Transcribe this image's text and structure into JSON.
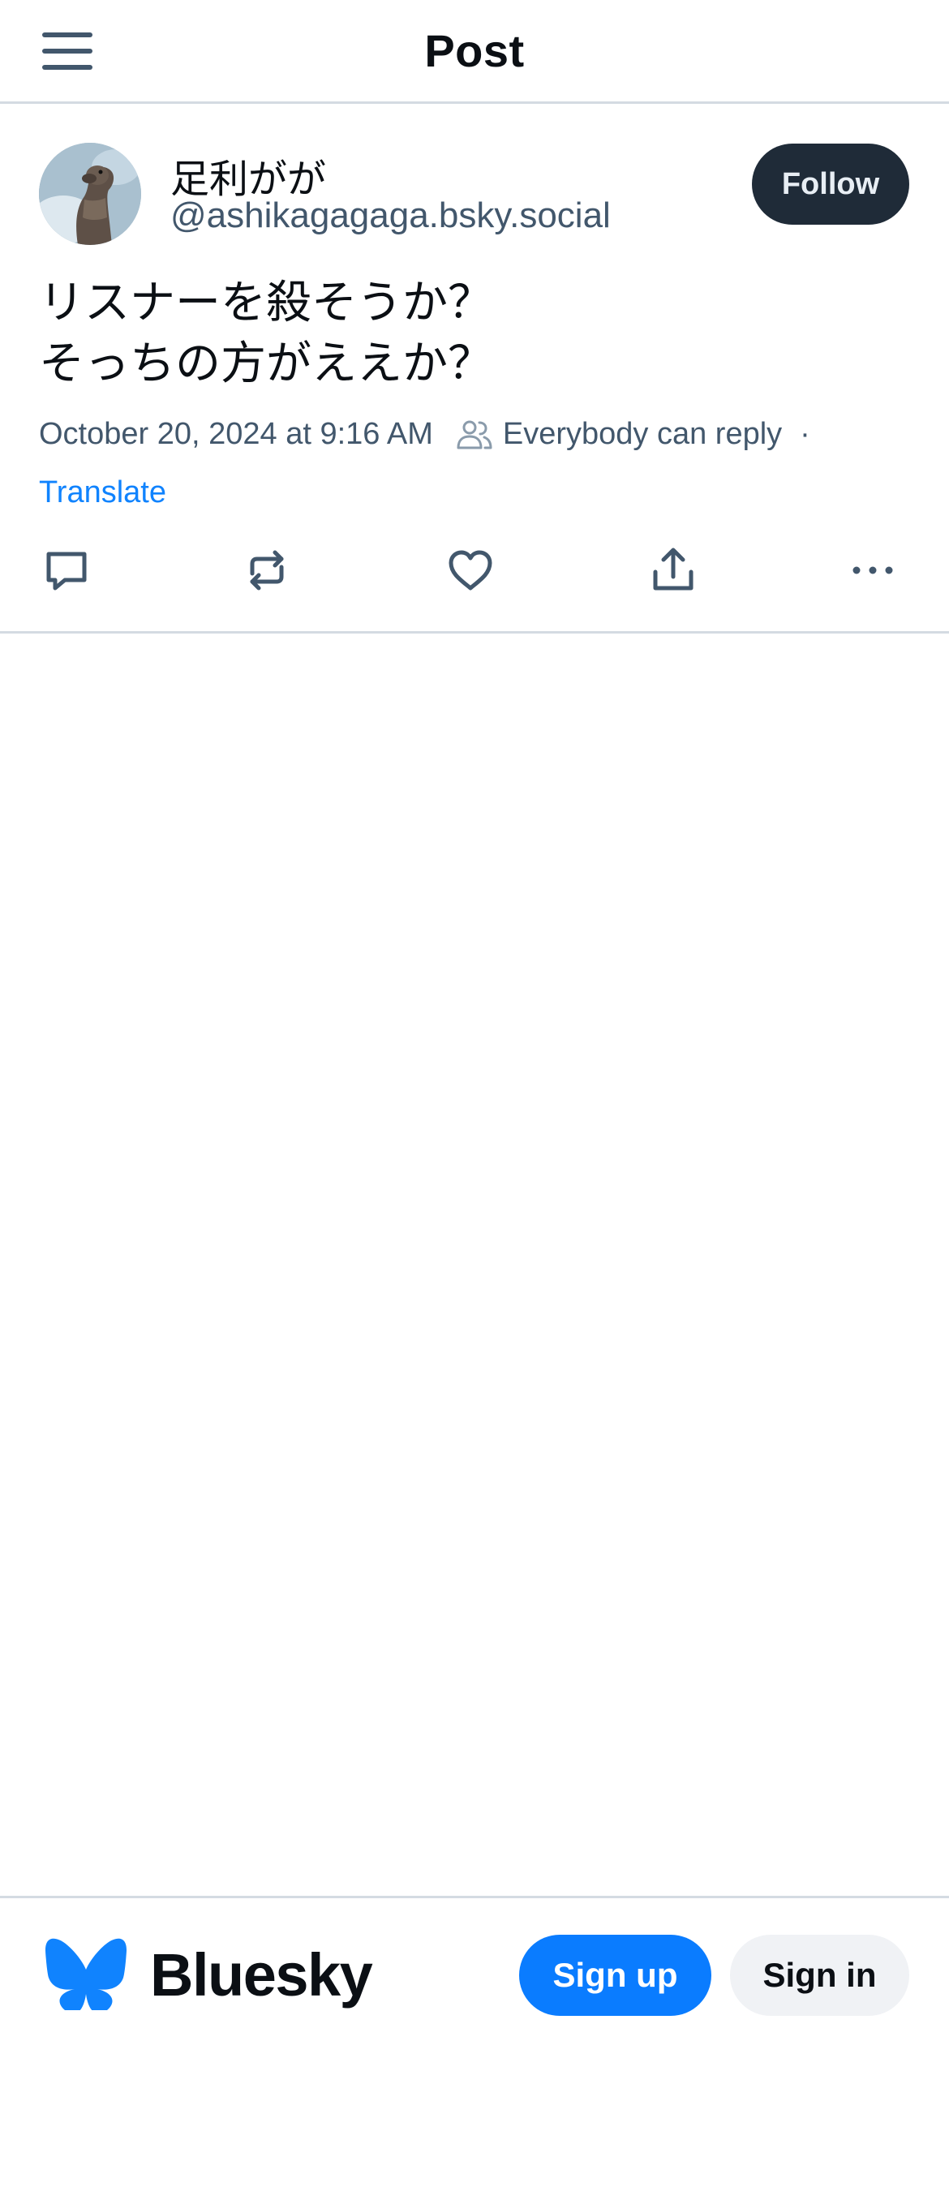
{
  "header": {
    "title": "Post",
    "menu_icon": "hamburger-menu-icon"
  },
  "post": {
    "author": {
      "display_name": "足利がが",
      "handle": "@ashikagagaga.bsky.social",
      "avatar": "sea-lion-photo"
    },
    "follow_label": "Follow",
    "text": "リスナーを殺そうか？\nそっちの方がええか？",
    "timestamp": "October 20, 2024 at 9:16 AM",
    "reply_setting": "Everybody can reply",
    "separator": "·",
    "translate_label": "Translate",
    "actions": [
      "reply-icon",
      "repost-icon",
      "like-icon",
      "share-icon",
      "more-icon"
    ]
  },
  "footer": {
    "brand": "Bluesky",
    "signup_label": "Sign up",
    "signin_label": "Sign in",
    "accent_color": "#0a7cff"
  },
  "colors": {
    "text": "#0b0f14",
    "muted": "#42576c",
    "link": "#1083fe",
    "follow_bg": "#1f2b38",
    "divider": "#d4dbe2"
  }
}
